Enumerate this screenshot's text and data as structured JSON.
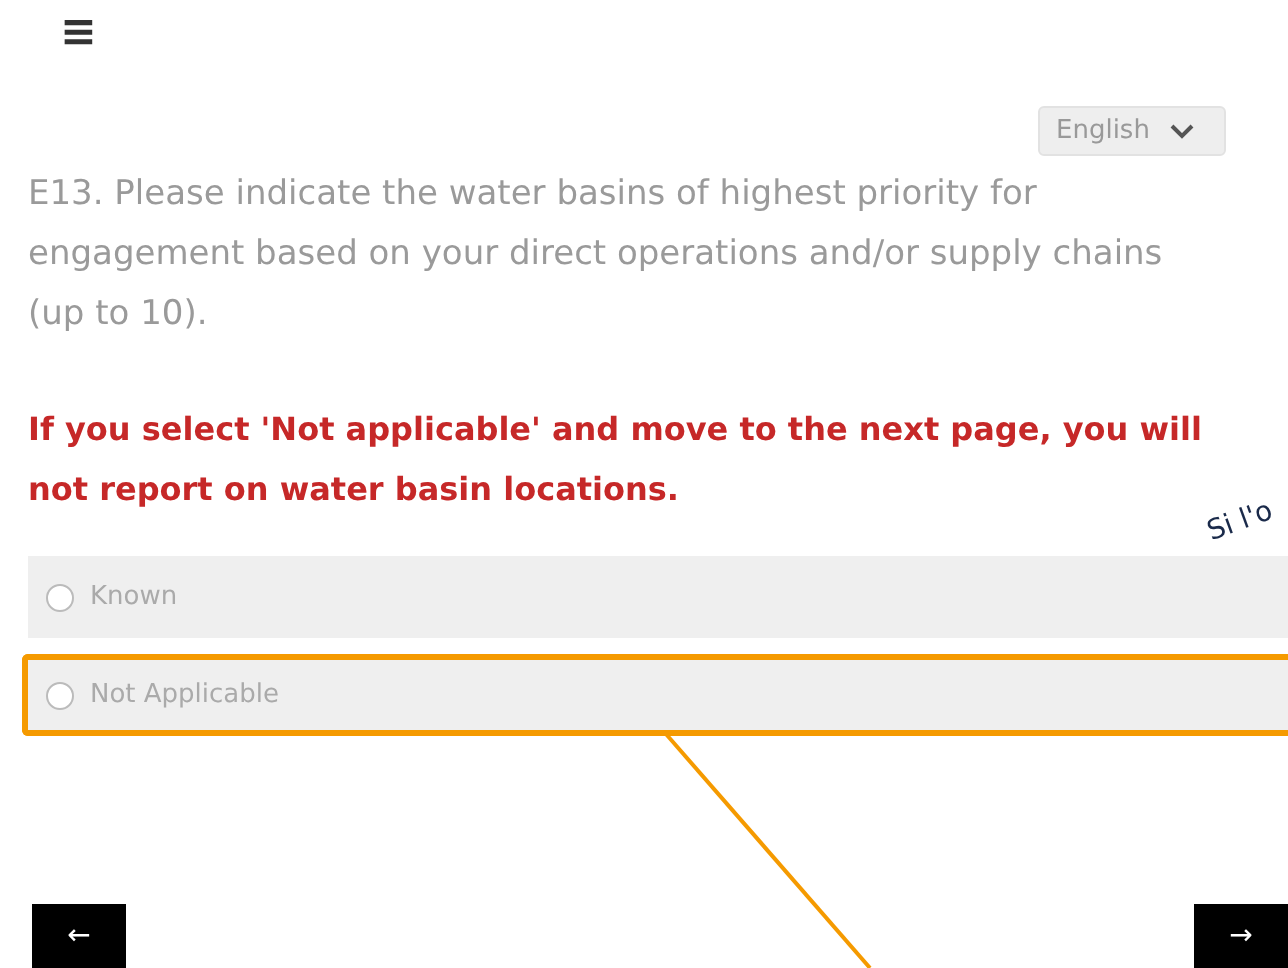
{
  "menu_icon": "≡",
  "language_select": {
    "value": "English"
  },
  "question": "E13. Please indicate the water basins of highest priority for engagement based on your direct operations and/or supply chains (up to 10).",
  "warning": "If you select 'Not applicable' and move to the next page, you will not report on water basin locations.",
  "options": [
    {
      "label": "Known",
      "selected": false,
      "highlighted": false
    },
    {
      "label": "Not Applicable",
      "selected": false,
      "highlighted": true
    }
  ],
  "nav": {
    "back": "←",
    "next": "→"
  },
  "annotation": {
    "text": "Si l'o"
  }
}
